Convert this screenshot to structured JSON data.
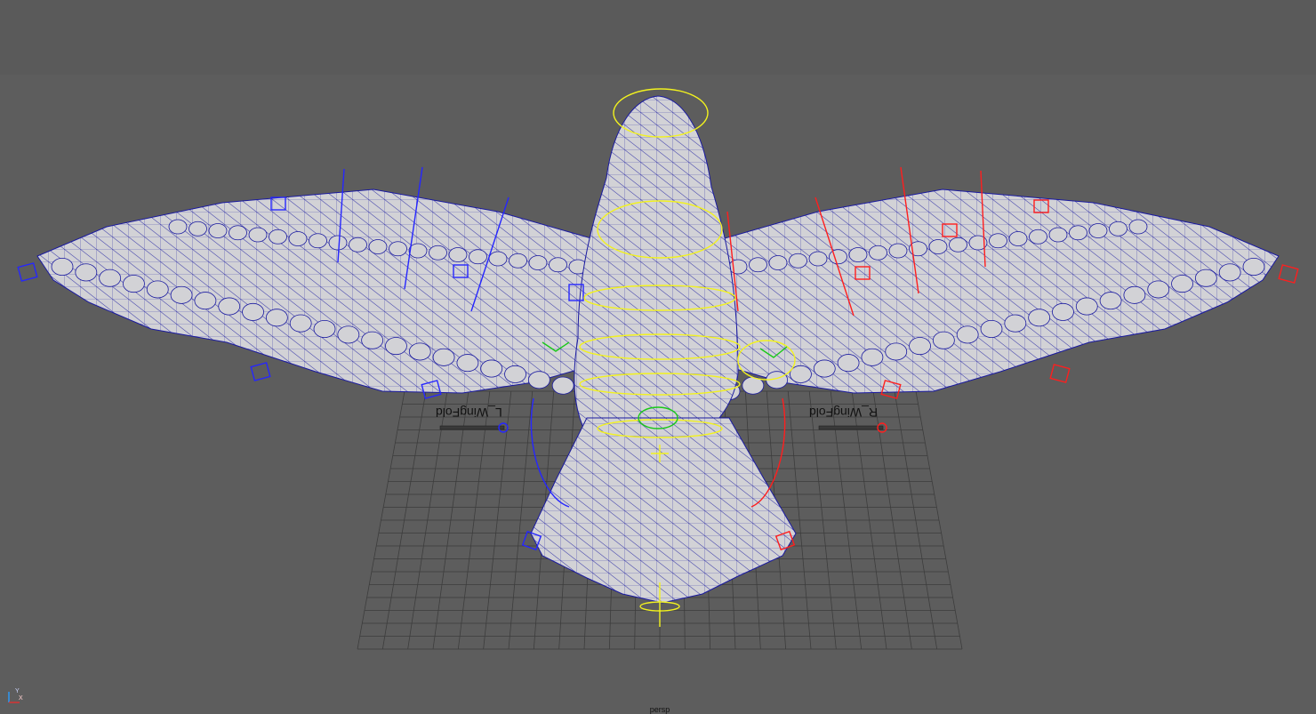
{
  "viewport": {
    "background_color": "#5d5d5d",
    "grid_color": "#3d3d3d",
    "mesh_fill": "#d2d2d6",
    "wire_color": "#1a1aa0",
    "left_controls_color": "#2626ff",
    "right_controls_color": "#ff1e1e",
    "center_controls_color": "#f2f21e",
    "accent_green": "#19c819",
    "camera_label": "persp"
  },
  "attributes": {
    "left_label": "L_WingFold",
    "right_label": "R_WingFold"
  },
  "axis": {
    "y_label": "Y",
    "x_label": "X"
  }
}
